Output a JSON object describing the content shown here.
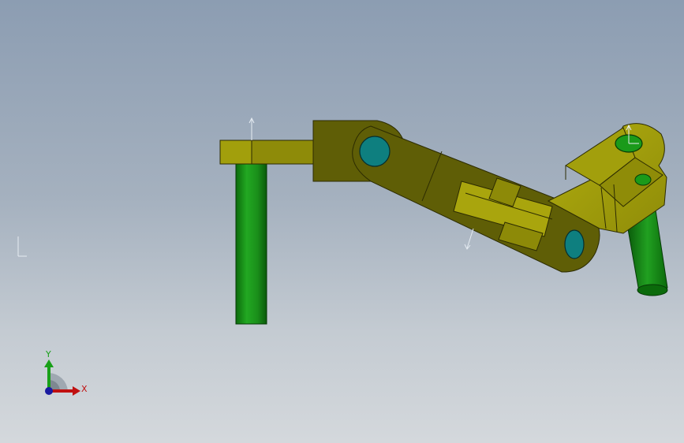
{
  "viewport": {
    "background_top": "#8c9db2",
    "background_bottom": "#d4d8dc"
  },
  "model": {
    "part_colors": {
      "link_body": "#a7a40c",
      "link_shadow": "#5f5e06",
      "link_dark": "#7d7b08",
      "shaft": "#1a9a1a",
      "shaft_dark": "#0b6a0b",
      "pin_hole": "#0e7f7f"
    }
  },
  "triad": {
    "x_label": "X",
    "y_label": "Y",
    "x_color": "#c01010",
    "y_color": "#18a018",
    "z_color": "#1a1aa0"
  }
}
